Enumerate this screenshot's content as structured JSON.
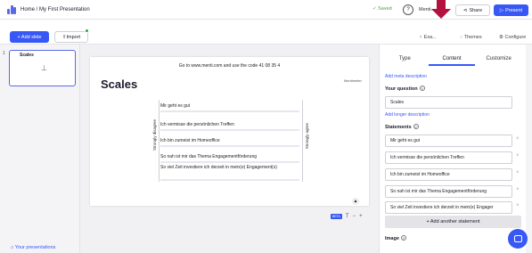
{
  "header": {
    "breadcrumb": "Home / My First Presentation",
    "saved": "✓ Saved",
    "help": "?",
    "user": "Menti...",
    "share": "Share",
    "present": "Present"
  },
  "toolbar": {
    "add_slide": "+ Add slide",
    "import": "Import",
    "examples": "Exa...",
    "themes": "Themes",
    "configure": "Configure"
  },
  "sidebar": {
    "slide_number": "1",
    "slide_title": "Scales",
    "your_presentations": "Your presentations"
  },
  "slide": {
    "code_text": "Go to www.menti.com and use the code 41 08 35 4",
    "title": "Scales",
    "brand": "Mentimeter",
    "left_label": "Strongly disagree",
    "right_label": "Strongly agree",
    "statements": [
      "Mir geht es gut",
      "Ich vermisse die persönlichen Treffen",
      "Ich bin zumeist im Homeoffice",
      "So nah ist mir das Thema Engagementförderung",
      "So viel Zeit investiere ich derzeit in mein(e) Engagement(s)"
    ]
  },
  "zoom": {
    "badge": "BETA",
    "tt": "T",
    "minus": "−",
    "plus": "+"
  },
  "panel": {
    "tabs": [
      "Type",
      "Content",
      "Customize"
    ],
    "active_tab": "Content",
    "add_meta": "Add meta description",
    "your_question_label": "Your question",
    "question_value": "Scales",
    "add_longer": "Add longer description",
    "statements_label": "Statements",
    "statements": [
      "Mir geht es gut",
      "Ich vermisse die persönlichen Treffen",
      "Ich bin zumeist im Homeoffice",
      "So nah ist mir das Thema Engagementförderung",
      "So viel Zeit investiere ich derzeit in mein(e) Engager"
    ],
    "add_statement": "+ Add another statement",
    "image_label": "Image"
  },
  "colors": {
    "accent": "#3858f6",
    "arrow": "#b3123f",
    "saved": "#45a05a"
  }
}
